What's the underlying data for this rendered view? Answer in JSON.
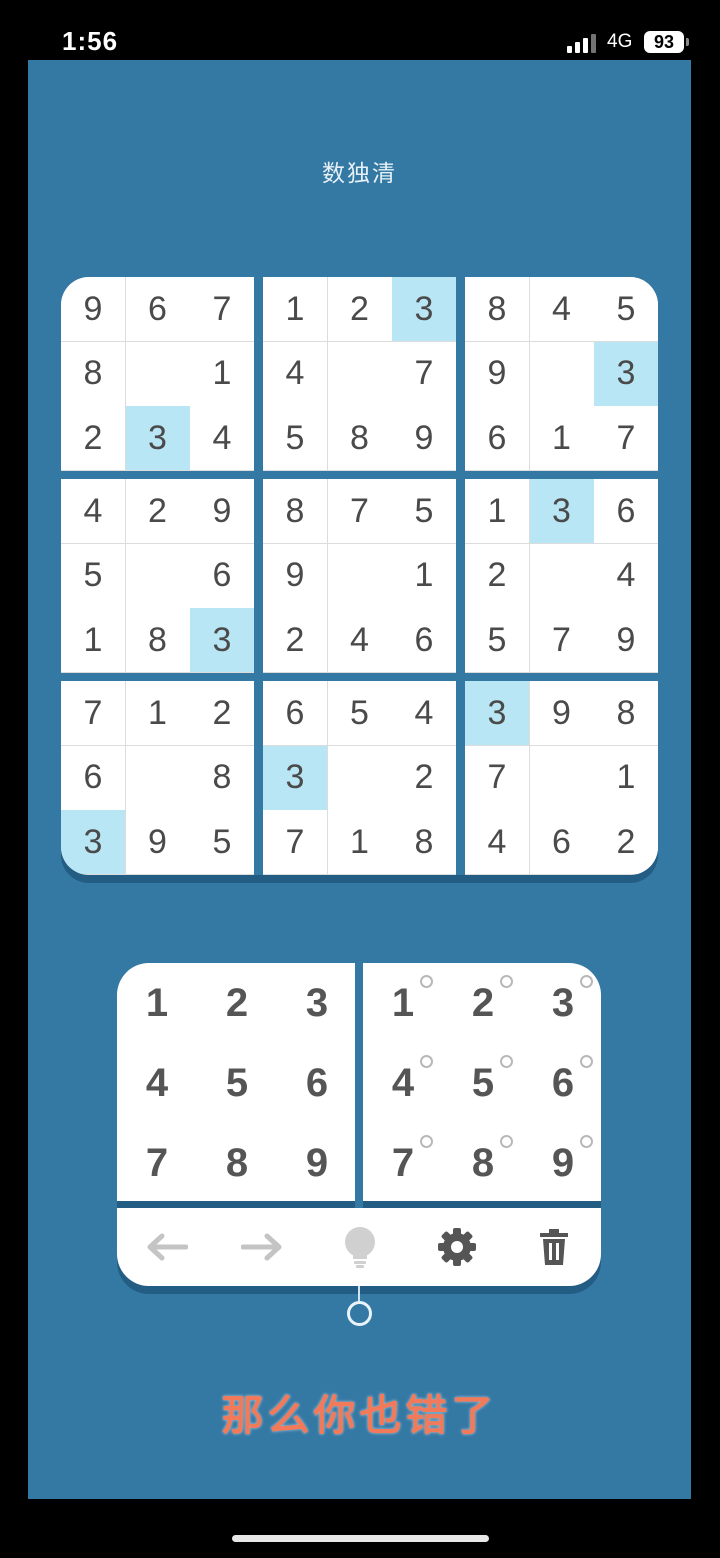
{
  "status_bar": {
    "time": "1:56",
    "network": "4G",
    "battery": "93"
  },
  "app": {
    "title": "数独清"
  },
  "board": [
    [
      9,
      6,
      7,
      1,
      2,
      3,
      8,
      4,
      5
    ],
    [
      8,
      null,
      1,
      4,
      null,
      7,
      9,
      null,
      3
    ],
    [
      2,
      3,
      4,
      5,
      8,
      9,
      6,
      1,
      7
    ],
    [
      4,
      2,
      9,
      8,
      7,
      5,
      1,
      3,
      6
    ],
    [
      5,
      null,
      6,
      9,
      null,
      1,
      2,
      null,
      4
    ],
    [
      1,
      8,
      3,
      2,
      4,
      6,
      5,
      7,
      9
    ],
    [
      7,
      1,
      2,
      6,
      5,
      4,
      3,
      9,
      8
    ],
    [
      6,
      null,
      8,
      3,
      null,
      2,
      7,
      null,
      1
    ],
    [
      3,
      9,
      5,
      7,
      1,
      8,
      4,
      6,
      2
    ]
  ],
  "highlight_color": "#b9e6f4",
  "number_pad": [
    "1",
    "2",
    "3",
    "4",
    "5",
    "6",
    "7",
    "8",
    "9"
  ],
  "note_pad": [
    "1",
    "2",
    "3",
    "4",
    "5",
    "6",
    "7",
    "8",
    "9"
  ],
  "toolbar": {
    "icons": [
      "undo-arrow-icon",
      "redo-arrow-icon",
      "hint-bulb-icon",
      "settings-gear-icon",
      "delete-trash-icon"
    ]
  },
  "subtitle": "那么你也错了",
  "colors": {
    "background": "#3478a4",
    "subtitle": "#f07a5a",
    "cell_text": "#4a4a4a"
  }
}
